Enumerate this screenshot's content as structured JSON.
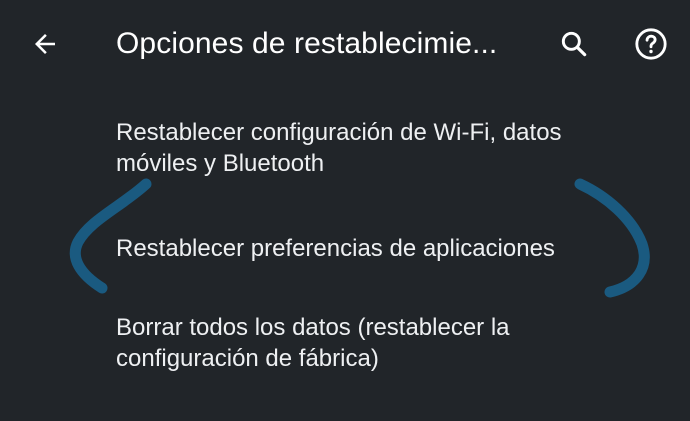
{
  "header": {
    "title": "Opciones de restablecimie...",
    "back_icon": "arrow-left-icon",
    "search_icon": "search-icon",
    "help_icon": "help-circle-icon"
  },
  "list": {
    "items": [
      {
        "label": "Restablecer configuración de Wi-Fi, datos móviles y Bluetooth"
      },
      {
        "label": "Restablecer preferencias de aplicaciones"
      },
      {
        "label": "Borrar todos los datos (restablecer la configuración de fábrica)"
      }
    ]
  },
  "colors": {
    "background": "#212529",
    "text": "#eef0f2",
    "annotation": "#1a5a80"
  }
}
